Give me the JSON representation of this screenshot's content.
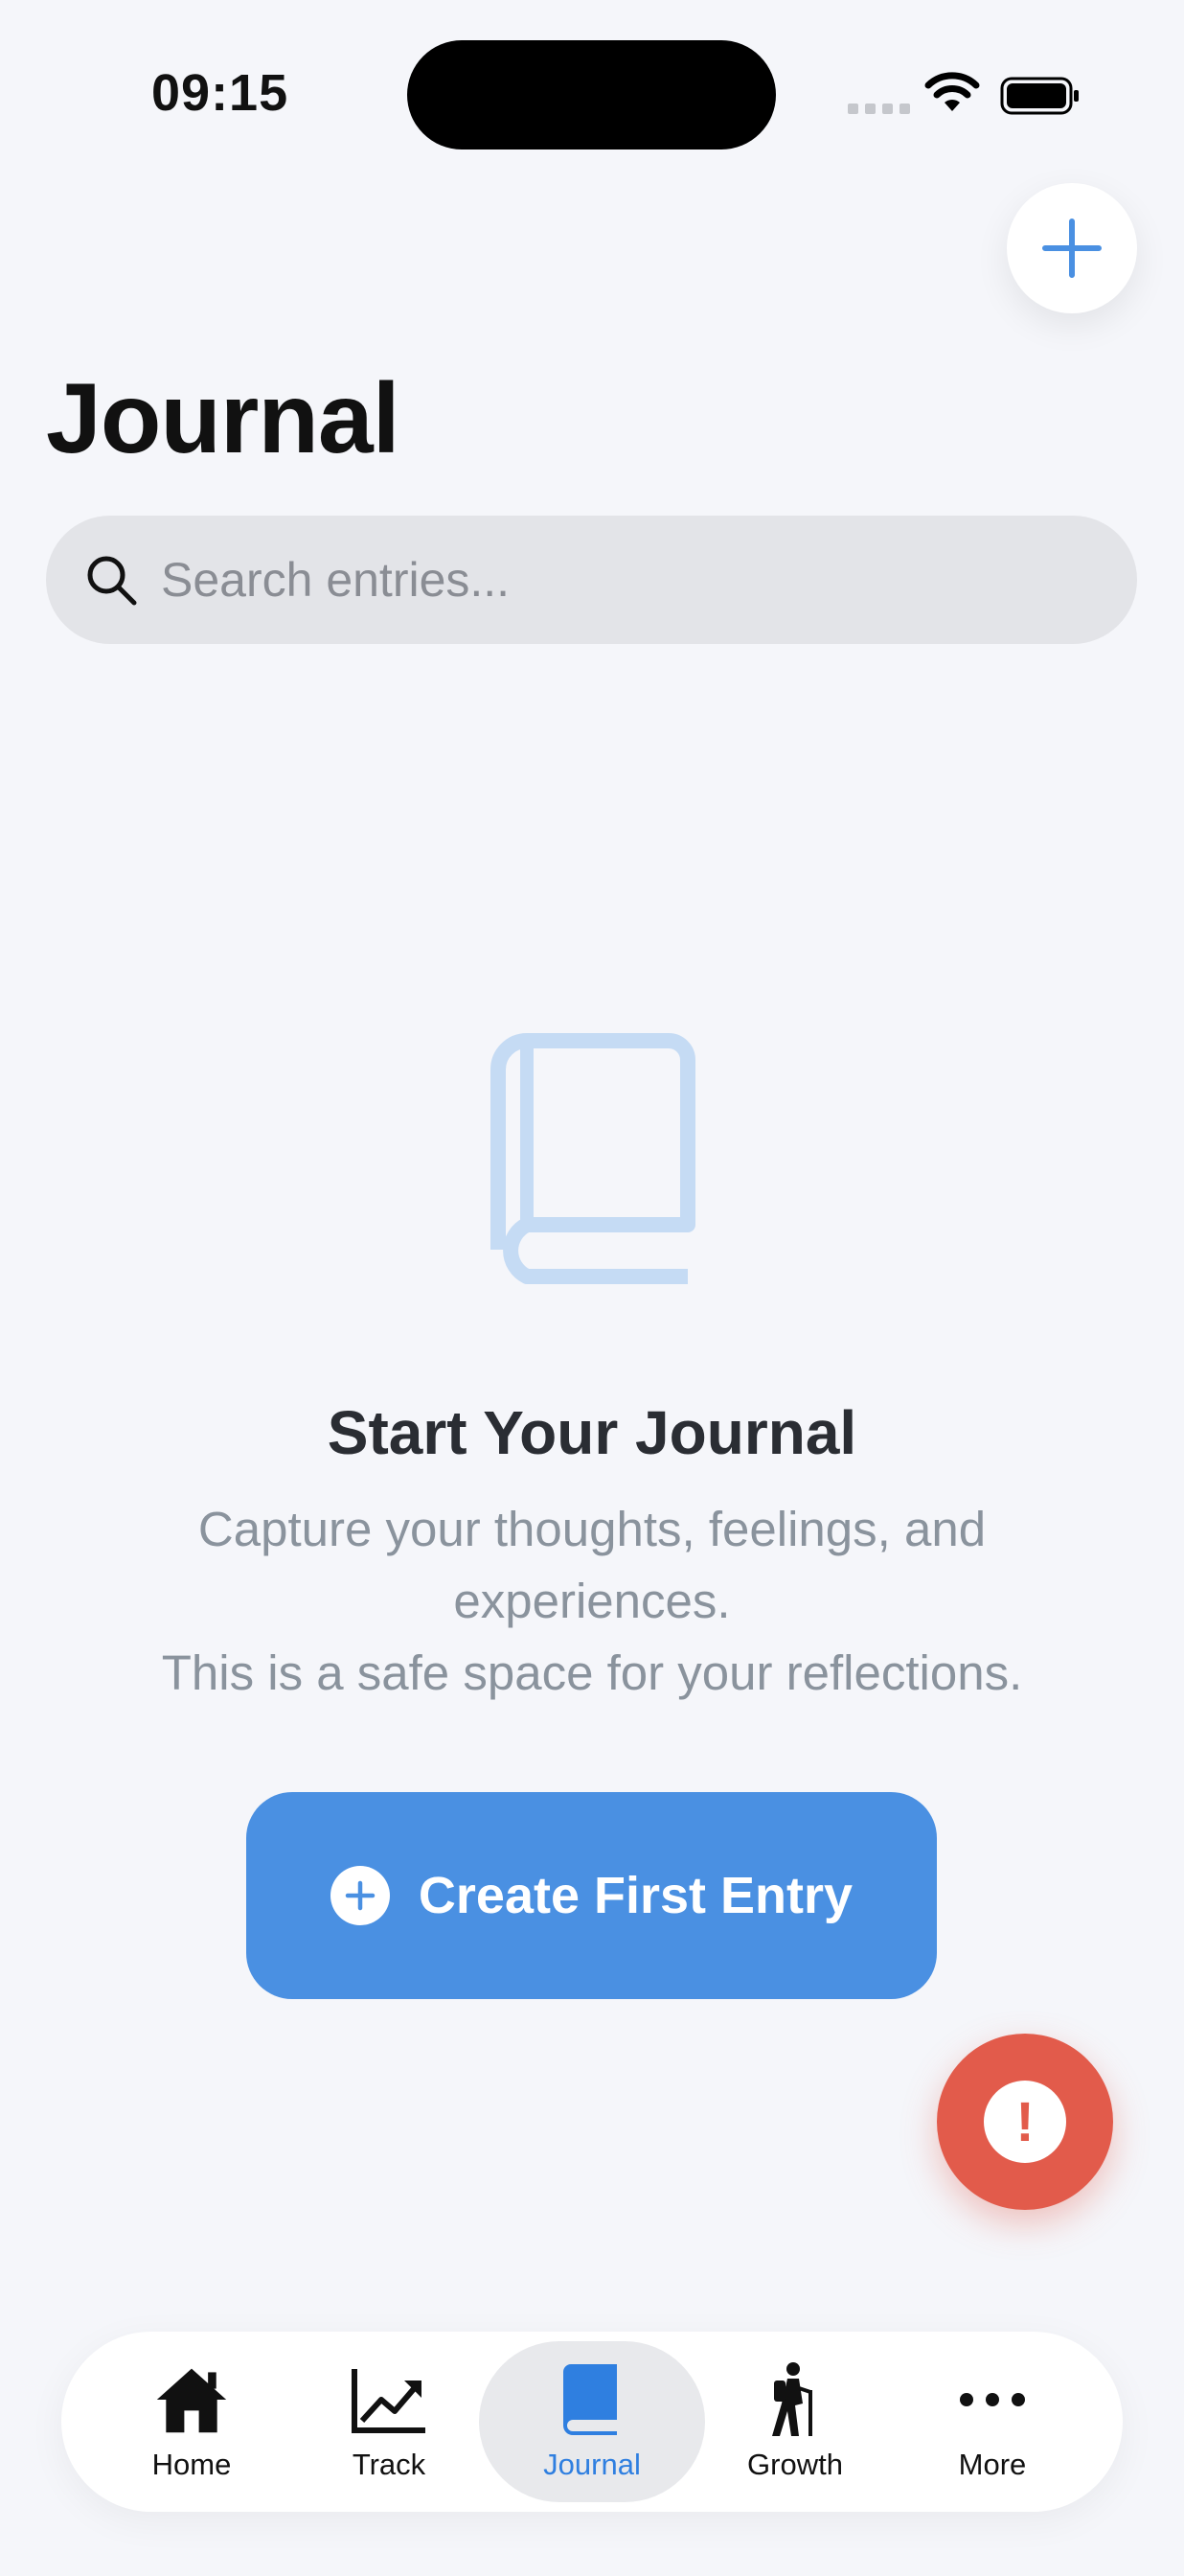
{
  "status_bar": {
    "time": "09:15"
  },
  "header": {
    "title": "Journal"
  },
  "search": {
    "placeholder": "Search entries..."
  },
  "empty_state": {
    "title": "Start Your Journal",
    "line1": "Capture your thoughts, feelings, and",
    "line2": "experiences.",
    "line3": "This is a safe space for your reflections."
  },
  "cta": {
    "label": "Create First Entry"
  },
  "alert": {
    "symbol": "!"
  },
  "colors": {
    "accent": "#4a90e2",
    "alert": "#e25b4b",
    "active_tab": "#2f7fe0"
  },
  "tabs": [
    {
      "label": "Home",
      "icon": "home-icon"
    },
    {
      "label": "Track",
      "icon": "chart-trend-icon"
    },
    {
      "label": "Journal",
      "icon": "book-icon",
      "active": true
    },
    {
      "label": "Growth",
      "icon": "hiker-icon"
    },
    {
      "label": "More",
      "icon": "ellipsis-icon"
    }
  ]
}
